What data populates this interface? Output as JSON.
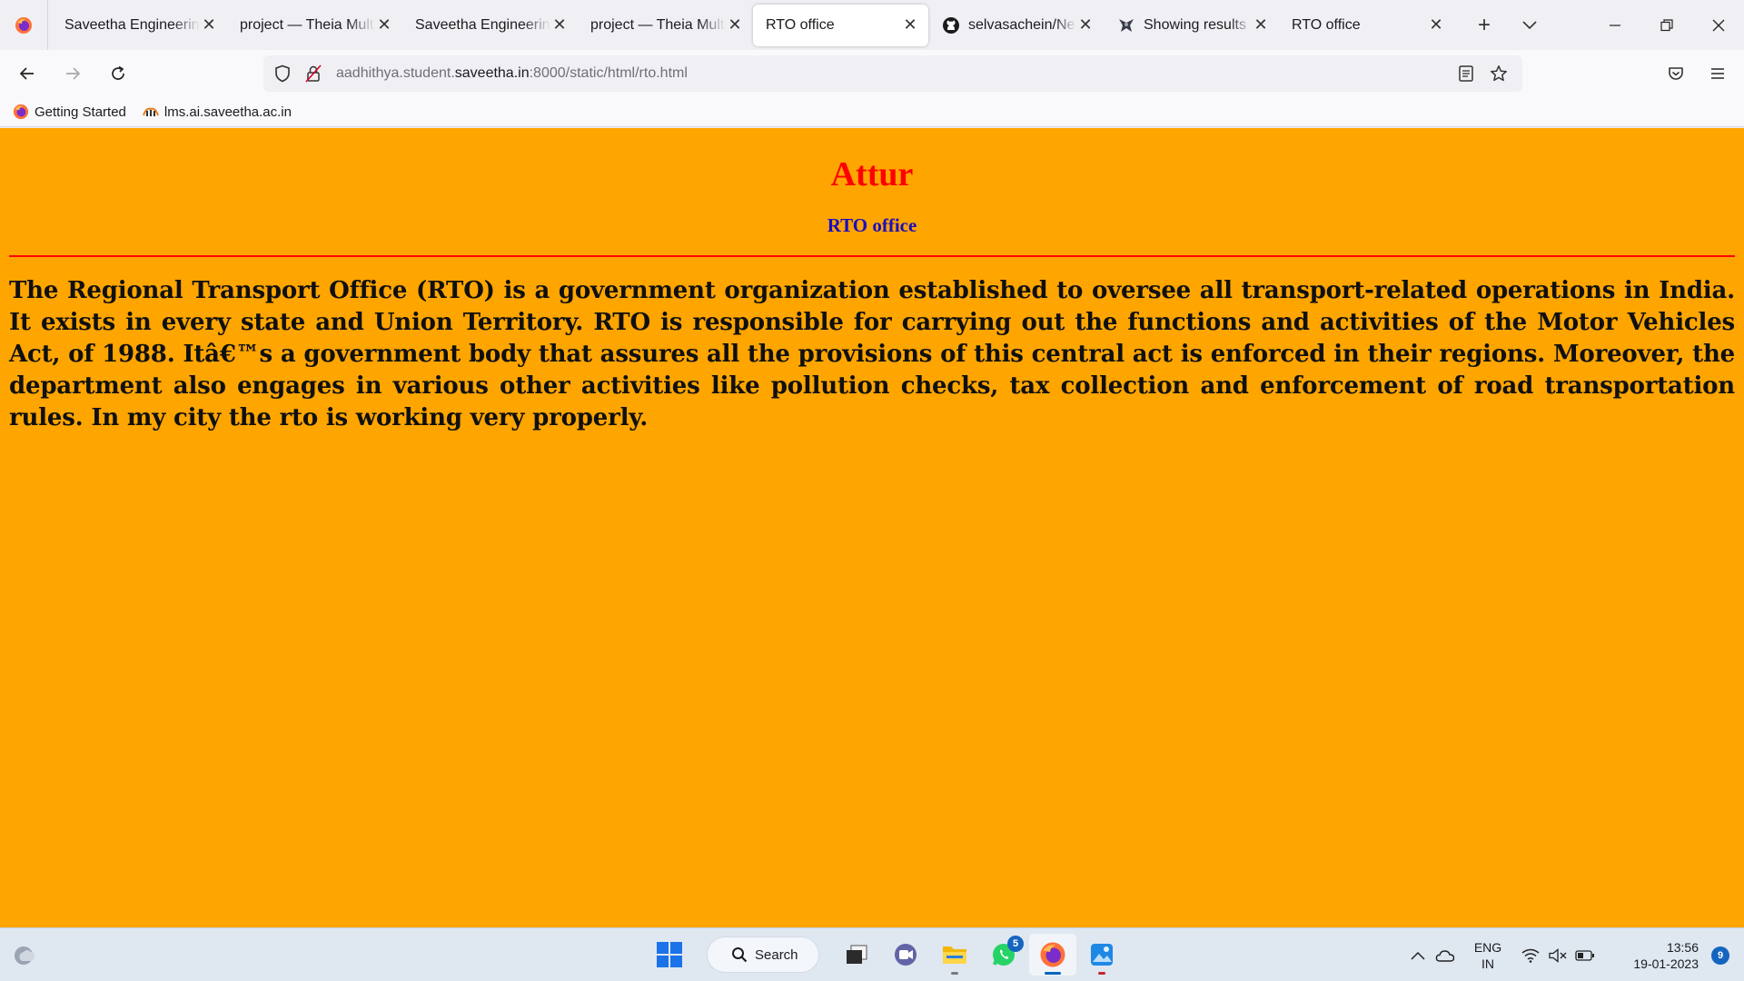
{
  "browser": {
    "tabs": [
      {
        "title": "Saveetha Engineering College",
        "favicon": "saveetha-icon",
        "active": false
      },
      {
        "title": "project — Theia Multi-Language",
        "favicon": "theia-icon",
        "active": false
      },
      {
        "title": "Saveetha Engineering College",
        "favicon": "saveetha-icon",
        "active": false
      },
      {
        "title": "project — Theia Multi-Language",
        "favicon": "theia-icon",
        "active": false
      },
      {
        "title": "RTO office",
        "favicon": "none",
        "active": true
      },
      {
        "title": "selvasachein/Nearby",
        "favicon": "github-icon",
        "active": false
      },
      {
        "title": "Showing results for",
        "favicon": "search-result-icon",
        "active": false
      },
      {
        "title": "RTO office",
        "favicon": "none",
        "active": false
      }
    ],
    "close_glyph": "✕",
    "new_tab_glyph": "+",
    "url": {
      "prefix": "aadhithya.student.",
      "domain": "saveetha.in",
      "suffix": ":8000/static/html/rto.html"
    },
    "bookmarks": [
      {
        "label": "Getting Started",
        "icon": "firefox-icon"
      },
      {
        "label": "lms.ai.saveetha.ac.in",
        "icon": "lms-icon"
      }
    ]
  },
  "page": {
    "heading": "Attur",
    "subheading": "RTO office",
    "paragraph": "The Regional Transport Office (RTO) is a government organization established to oversee all transport-related operations in India. It exists in every state and Union Territory. RTO is responsible for carrying out the functions and activities of the Motor Vehicles Act, of 1988. Itâ€™s a government body that assures all the provisions of this central act is enforced in their regions. Moreover, the department also engages in various other activities like pollution checks, tax collection and enforcement of road transportation rules. In my city the rto is working very properly.",
    "colors": {
      "background": "#ffa500",
      "heading": "#ff0000",
      "subheading": "#1a0dbf",
      "rule": "#ff0000"
    }
  },
  "taskbar": {
    "search_label": "Search",
    "whatsapp_badge": "5",
    "language_line1": "ENG",
    "language_line2": "IN",
    "time": "13:56",
    "date": "19-01-2023",
    "notification_count": "9"
  }
}
